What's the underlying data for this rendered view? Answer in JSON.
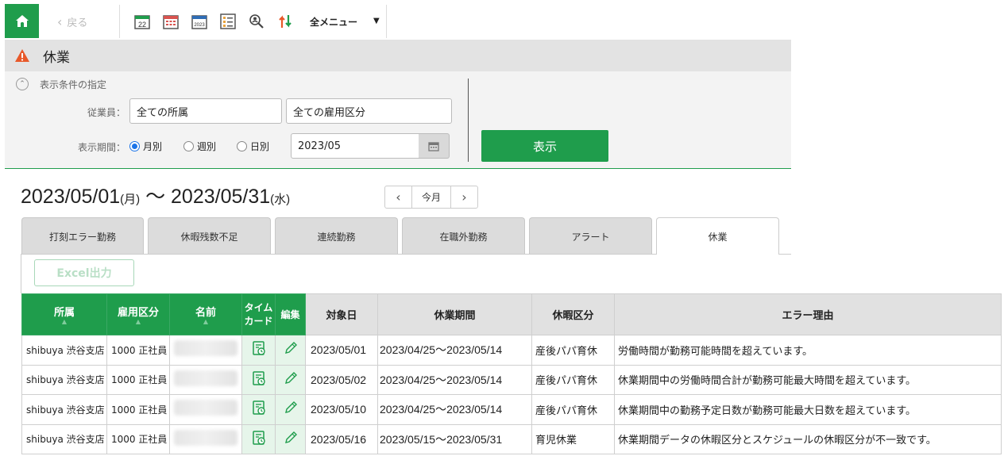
{
  "toolbar": {
    "back_label": "戻る",
    "cal_day_number": "22",
    "cal_year_text": "2023",
    "menu_label": "全メニュー"
  },
  "page": {
    "title": "休業"
  },
  "filter": {
    "section_label": "表示条件の指定",
    "employee_label": "従業員：",
    "org_value": "全ての所属",
    "employment_value": "全ての雇用区分",
    "period_label": "表示期間：",
    "radio_monthly": "月別",
    "radio_weekly": "週別",
    "radio_daily": "日別",
    "selected_period": "monthly",
    "month_value": "2023/05",
    "show_button": "表示"
  },
  "period": {
    "start": "2023/05/01",
    "start_dow": "(月)",
    "sep": " 〜 ",
    "end": "2023/05/31",
    "end_dow": "(水)",
    "this_month": "今月"
  },
  "tabs": [
    {
      "label": "打刻エラー勤務"
    },
    {
      "label": "休暇残数不足"
    },
    {
      "label": "連続勤務"
    },
    {
      "label": "在職外勤務"
    },
    {
      "label": "アラート"
    },
    {
      "label": "休業",
      "active": true
    }
  ],
  "excel_button": "Excel出力",
  "table": {
    "headers": {
      "org": "所属",
      "employment": "雇用区分",
      "name": "名前",
      "timecard_1": "タイム",
      "timecard_2": "カード",
      "edit": "編集",
      "target_date": "対象日",
      "leave_period": "休業期間",
      "leave_type": "休暇区分",
      "error_reason": "エラー理由"
    },
    "rows": [
      {
        "org": "shibuya 渋谷支店",
        "employment": "1000 正社員",
        "target_date": "2023/05/01",
        "leave_period": "2023/04/25〜2023/05/14",
        "leave_type": "産後パパ育休",
        "error_reason": "労働時間が勤務可能時間を超えています。"
      },
      {
        "org": "shibuya 渋谷支店",
        "employment": "1000 正社員",
        "target_date": "2023/05/02",
        "leave_period": "2023/04/25〜2023/05/14",
        "leave_type": "産後パパ育休",
        "error_reason": "休業期間中の労働時間合計が勤務可能最大時間を超えています。"
      },
      {
        "org": "shibuya 渋谷支店",
        "employment": "1000 正社員",
        "target_date": "2023/05/10",
        "leave_period": "2023/04/25〜2023/05/14",
        "leave_type": "産後パパ育休",
        "error_reason": "休業期間中の勤務予定日数が勤務可能最大日数を超えています。"
      },
      {
        "org": "shibuya 渋谷支店",
        "employment": "1000 正社員",
        "target_date": "2023/05/16",
        "leave_period": "2023/05/15〜2023/05/31",
        "leave_type": "育児休業",
        "error_reason": "休業期間データの休暇区分とスケジュールの休暇区分が不一致です。"
      }
    ]
  },
  "colors": {
    "accent": "#1f9d4c",
    "warning": "#e8592a"
  },
  "icons": [
    "home-icon",
    "chevron-left-icon",
    "calendar-day-icon",
    "calendar-month-icon",
    "calendar-year-icon",
    "list-icon",
    "search-person-icon",
    "sort-arrows-icon",
    "warning-icon",
    "timecard-icon",
    "pencil-icon"
  ]
}
